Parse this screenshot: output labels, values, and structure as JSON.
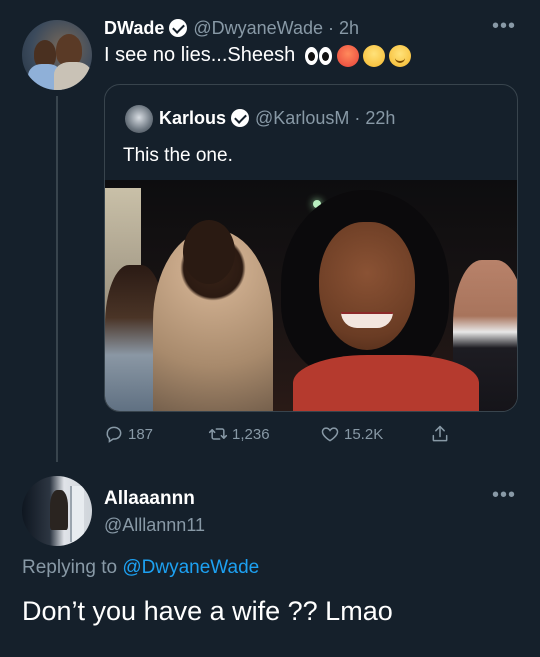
{
  "tweet": {
    "display_name": "DWade",
    "handle": "@DwyaneWade",
    "time": "· 2h",
    "text": "I see no lies...Sheesh",
    "emojis": [
      "eyes-emoji",
      "hot-face-emoji",
      "huffing-face-emoji",
      "relieved-face-emoji"
    ]
  },
  "quoted": {
    "display_name": "Karlous",
    "handle": "@KarlousM",
    "time": "· 22h",
    "text": "This the one."
  },
  "actions": {
    "replies": "187",
    "retweets": "1,236",
    "likes": "15.2K"
  },
  "reply": {
    "display_name": "Allaaannn",
    "handle": "@Alllannn11",
    "replying_prefix": "Replying to",
    "replying_to": "@DwyaneWade",
    "text": "Don’t you have a wife ?? Lmao"
  },
  "more_label": "•••",
  "colors": {
    "background": "#15202b",
    "muted": "#8899a6",
    "link": "#1da1f2",
    "border": "#38444d"
  }
}
